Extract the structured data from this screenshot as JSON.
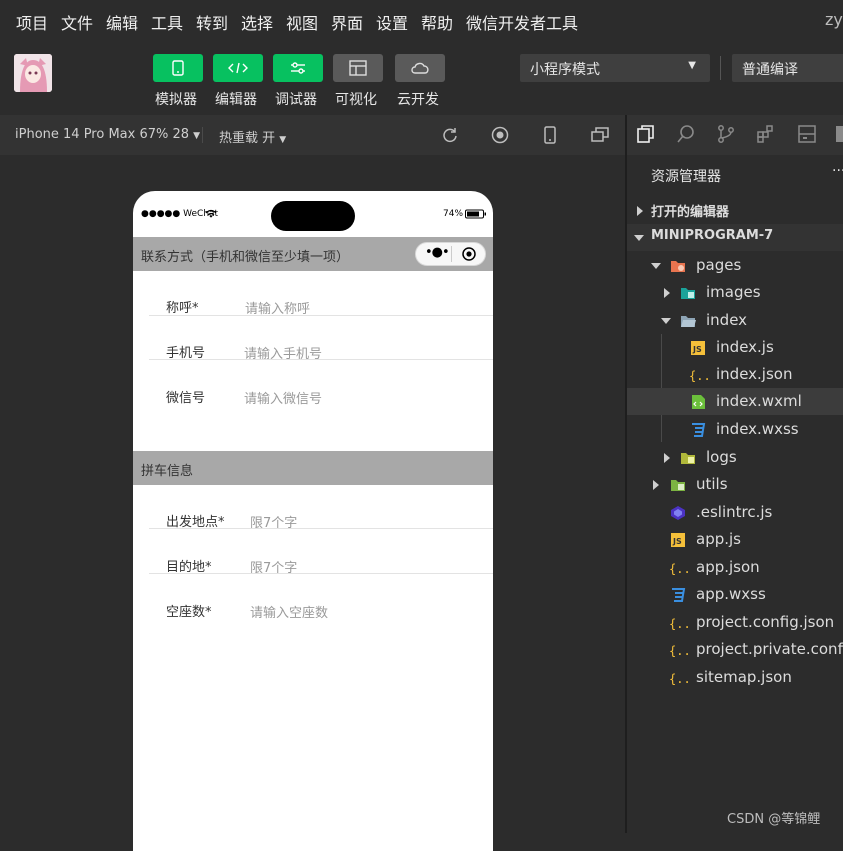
{
  "menu": {
    "items": [
      "项目",
      "文件",
      "编辑",
      "工具",
      "转到",
      "选择",
      "视图",
      "界面",
      "设置",
      "帮助",
      "微信开发者工具"
    ],
    "right_truncated": "zy-"
  },
  "toolbar": {
    "buttons": [
      "模拟器",
      "编辑器",
      "调试器",
      "可视化",
      "云开发"
    ],
    "mode_select": "小程序模式",
    "compile_select": "普通编译"
  },
  "simbar": {
    "device": "iPhone 14 Pro Max 67% 28",
    "hot_reload": "热重载 开"
  },
  "phone": {
    "status_left": "●●●●● WeChat",
    "battery": "74%",
    "section1": "联系方式（手机和微信至少填一项）",
    "fields1": [
      {
        "label": "称呼*",
        "placeholder": "请输入称呼"
      },
      {
        "label": "手机号",
        "placeholder": "请输入手机号"
      },
      {
        "label": "微信号",
        "placeholder": "请输入微信号"
      }
    ],
    "section2": "拼车信息",
    "fields2": [
      {
        "label": "出发地点*",
        "placeholder": "限7个字"
      },
      {
        "label": "目的地*",
        "placeholder": "限7个字"
      },
      {
        "label": "空座数*",
        "placeholder": "请输入空座数"
      }
    ]
  },
  "explorer": {
    "title": "资源管理器",
    "more": "···",
    "open_editors": "打开的编辑器",
    "project": "MINIPROGRAM-7",
    "tree": [
      "pages",
      "images",
      "index",
      "index.js",
      "index.json",
      "index.wxml",
      "index.wxss",
      "logs",
      "utils",
      ".eslintrc.js",
      "app.js",
      "app.json",
      "app.wxss",
      "project.config.json",
      "project.private.config",
      "sitemap.json"
    ]
  },
  "watermark": "CSDN @等锦鲤",
  "colors": {
    "accent": "#07c160",
    "section": "#a8a8a8",
    "selected_row": "#3c3c3c"
  }
}
